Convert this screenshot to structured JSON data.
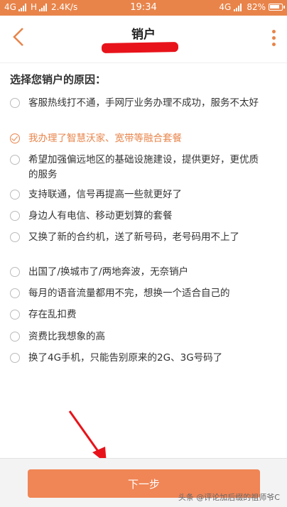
{
  "statusbar": {
    "left_net": "4G",
    "left_net2": "H",
    "speed": "2.4K/s",
    "time": "19:34",
    "right_net": "4G",
    "battery": "82%"
  },
  "header": {
    "title": "销户"
  },
  "content": {
    "prompt": "选择您销户的原因：",
    "options": [
      {
        "label": "客服热线打不通，手网厅业务办理不成功，服务不太好",
        "selected": false
      },
      {
        "label": "我办理了智慧沃家、宽带等融合套餐",
        "selected": true
      },
      {
        "label": "希望加强偏远地区的基础设施建设，提供更好，更优质的服务",
        "selected": false
      },
      {
        "label": "支持联通，信号再提高一些就更好了",
        "selected": false
      },
      {
        "label": "身边人有电信、移动更划算的套餐",
        "selected": false
      },
      {
        "label": "又换了新的合约机，送了新号码，老号码用不上了",
        "selected": false
      },
      {
        "label": "出国了/换城市了/两地奔波，无奈销户",
        "selected": false
      },
      {
        "label": "每月的语音流量都用不完，想换一个适合自己的",
        "selected": false
      },
      {
        "label": "存在乱扣费",
        "selected": false
      },
      {
        "label": "资费比我想象的高",
        "selected": false
      },
      {
        "label": "换了4G手机，只能告别原来的2G、3G号码了",
        "selected": false
      }
    ]
  },
  "footer": {
    "next_label": "下一步",
    "watermark": "头条 @评论加后缀的祖师爷C"
  },
  "colors": {
    "accent": "#e8844a",
    "button": "#f08555",
    "annotation": "#e8131a"
  }
}
